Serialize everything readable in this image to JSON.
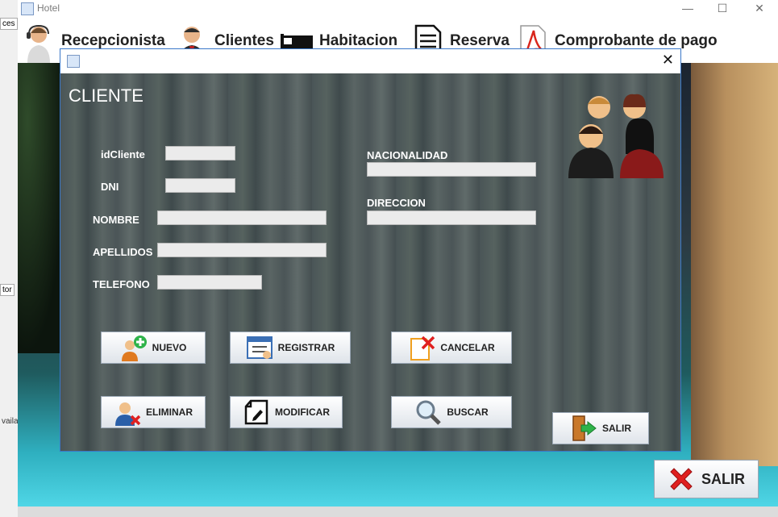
{
  "window": {
    "title": "Hotel"
  },
  "window_controls": {
    "minimize": "—",
    "maximize": "☐",
    "close": "✕"
  },
  "left_edge": {
    "frag1": "ces",
    "frag2": "tor",
    "frag3": "vaila"
  },
  "menu": {
    "items": [
      {
        "label": "Recepcionista",
        "icon": "receptionist-icon"
      },
      {
        "label": "Clientes",
        "icon": "businessman-icon"
      },
      {
        "label": "Habitacion",
        "icon": "bed-icon"
      },
      {
        "label": "Reserva",
        "icon": "document-icon"
      },
      {
        "label": "Comprobante de pago",
        "icon": "pdf-icon"
      }
    ]
  },
  "dialog": {
    "close": "✕",
    "heading": "CLIENTE",
    "fields": {
      "idcliente": {
        "label": "idCliente",
        "value": ""
      },
      "dni": {
        "label": "DNI",
        "value": ""
      },
      "nombre": {
        "label": "NOMBRE",
        "value": ""
      },
      "apellidos": {
        "label": "APELLIDOS",
        "value": ""
      },
      "telefono": {
        "label": "TELEFONO",
        "value": ""
      },
      "nacionalidad": {
        "label": "NACIONALIDAD",
        "value": ""
      },
      "direccion": {
        "label": "DIRECCION",
        "value": ""
      }
    },
    "buttons": {
      "nuevo": "NUEVO",
      "registrar": "REGISTRAR",
      "cancelar": "CANCELAR",
      "eliminar": "ELIMINAR",
      "modificar": "MODIFICAR",
      "buscar": "BUSCAR",
      "salir": "SALIR"
    }
  },
  "main_salir": "SALIR",
  "colors": {
    "accent_border": "#3a78c9",
    "panel": "#4f5b5c",
    "field_bg": "#ebebeb",
    "red_x": "#e02020",
    "green_arrow": "#2fb34a"
  }
}
